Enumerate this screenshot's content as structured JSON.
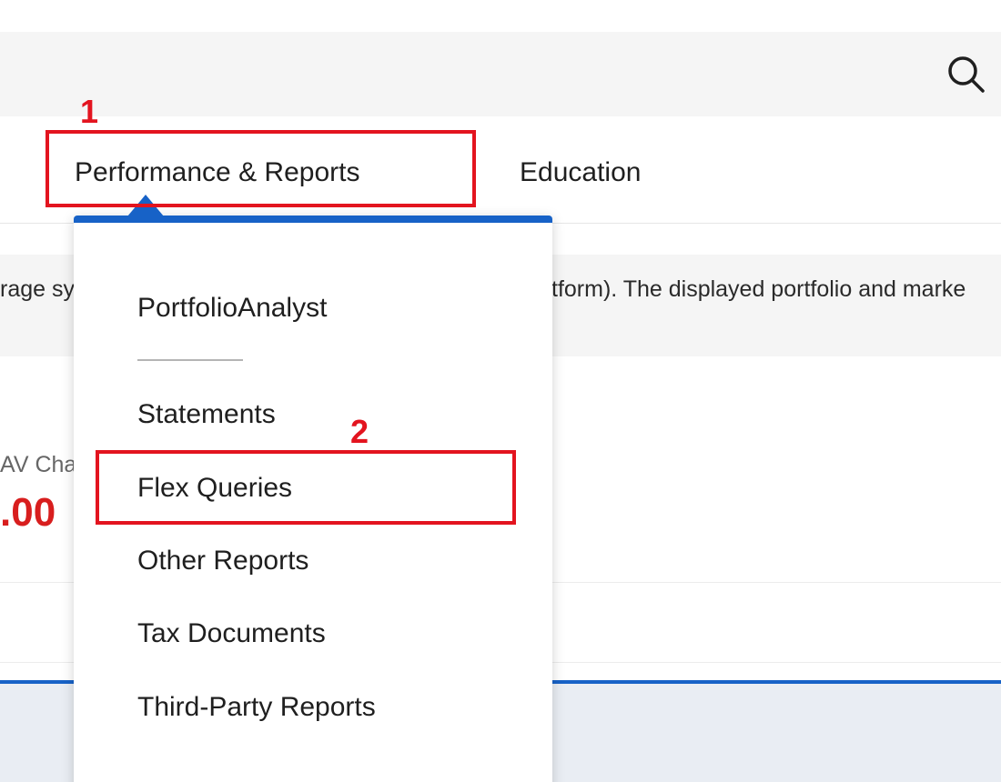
{
  "search": {
    "icon": "search-icon"
  },
  "nav": {
    "items": [
      {
        "label": "Performance & Reports"
      },
      {
        "label": "Education"
      }
    ]
  },
  "notice": {
    "left_fragment": "rage sy",
    "right_fragment": "tform). The displayed portfolio and marke"
  },
  "summary": {
    "nav_change_label": "AV Cha",
    "nav_change_value": ".00"
  },
  "dropdown": {
    "items": [
      {
        "label": "PortfolioAnalyst"
      },
      {
        "label": "Statements"
      },
      {
        "label": "Flex Queries"
      },
      {
        "label": "Other Reports"
      },
      {
        "label": "Tax Documents"
      },
      {
        "label": "Third-Party Reports"
      }
    ]
  },
  "annotations": {
    "step1": "1",
    "step2": "2"
  },
  "colors": {
    "accent_blue": "#1762c7",
    "annotation_red": "#e3141f",
    "negative_red": "#d81e1e"
  }
}
